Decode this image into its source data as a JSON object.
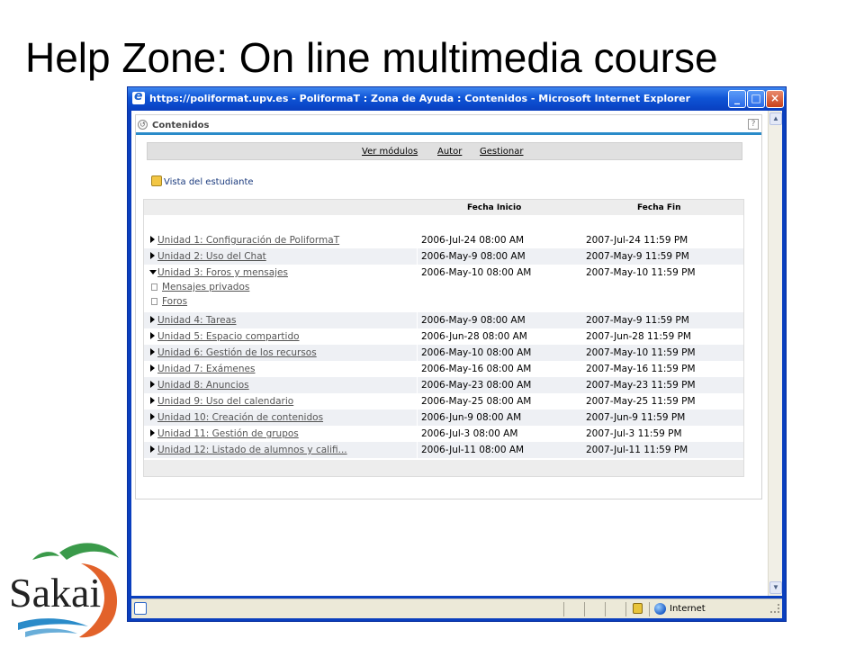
{
  "slide": {
    "title": "Help Zone: On line multimedia course"
  },
  "window": {
    "title": "https://poliformat.upv.es - PoliformaT : Zona de Ayuda : Contenidos - Microsoft Internet Explorer",
    "buttons": {
      "minimize": "_",
      "maximize": "□",
      "close": "×"
    }
  },
  "status_bar": {
    "zone": "Internet"
  },
  "portlet": {
    "title": "Contenidos",
    "help": "?",
    "toolbar": [
      "Ver módulos",
      "Autor",
      "Gestionar"
    ],
    "student_view": "Vista del estudiante",
    "columns": {
      "start": "Fecha Inicio",
      "end": "Fecha Fin"
    },
    "units": [
      {
        "name": "Unidad 1: Configuración de PoliformaT",
        "start": "2006-Jul-24 08:00 AM",
        "end": "2007-Jul-24 11:59 PM"
      },
      {
        "name": "Unidad 2: Uso del Chat",
        "start": "2006-May-9 08:00 AM",
        "end": "2007-May-9 11:59 PM"
      },
      {
        "name": "Unidad 3: Foros y mensajes",
        "start": "2006-May-10 08:00 AM",
        "end": "2007-May-10 11:59 PM",
        "expanded": true,
        "children": [
          "Mensajes privados",
          "Foros"
        ]
      },
      {
        "name": "Unidad 4: Tareas",
        "start": "2006-May-9 08:00 AM",
        "end": "2007-May-9 11:59 PM"
      },
      {
        "name": "Unidad 5: Espacio compartido",
        "start": "2006-Jun-28 08:00 AM",
        "end": "2007-Jun-28 11:59 PM"
      },
      {
        "name": "Unidad 6: Gestión de los recursos",
        "start": "2006-May-10 08:00 AM",
        "end": "2007-May-10 11:59 PM"
      },
      {
        "name": "Unidad 7: Exámenes",
        "start": "2006-May-16 08:00 AM",
        "end": "2007-May-16 11:59 PM"
      },
      {
        "name": "Unidad 8: Anuncios",
        "start": "2006-May-23 08:00 AM",
        "end": "2007-May-23 11:59 PM"
      },
      {
        "name": "Unidad 9: Uso del calendario",
        "start": "2006-May-25 08:00 AM",
        "end": "2007-May-25 11:59 PM"
      },
      {
        "name": "Unidad 10: Creación de contenidos",
        "start": "2006-Jun-9 08:00 AM",
        "end": "2007-Jun-9 11:59 PM"
      },
      {
        "name": "Unidad 11: Gestión de grupos",
        "start": "2006-Jul-3 08:00 AM",
        "end": "2007-Jul-3 11:59 PM"
      },
      {
        "name": "Unidad 12: Listado de alumnos y califi...",
        "start": "2006-Jul-11 08:00 AM",
        "end": "2007-Jul-11 11:59 PM"
      }
    ]
  },
  "logo": {
    "text": "Sakai"
  },
  "colors": {
    "xp_blue": "#0a3fbe",
    "accent_rule": "#2a8bc9",
    "logo_green": "#3a9a4a",
    "logo_orange": "#e2622a"
  }
}
